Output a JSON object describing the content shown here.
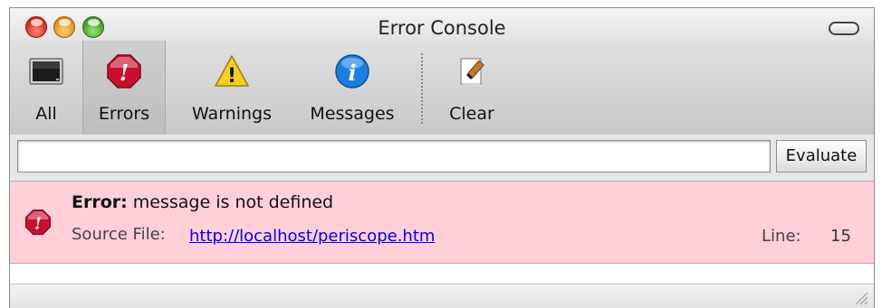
{
  "window": {
    "title": "Error Console"
  },
  "toolbar": {
    "items": [
      {
        "label": "All",
        "icon": "monitor-icon"
      },
      {
        "label": "Errors",
        "icon": "error-stop-icon",
        "selected": true
      },
      {
        "label": "Warnings",
        "icon": "warning-icon"
      },
      {
        "label": "Messages",
        "icon": "info-icon"
      },
      {
        "label": "Clear",
        "icon": "eraser-icon"
      }
    ]
  },
  "evaluate": {
    "value": "",
    "placeholder": "",
    "button_label": "Evaluate"
  },
  "messages": [
    {
      "type_label": "Error:",
      "text": "message is not defined",
      "source_label": "Source File:",
      "source_url": "http://localhost/periscope.htm",
      "line_label": "Line:",
      "line": "15"
    }
  ],
  "colors": {
    "error_row_bg": "#ffd0d8",
    "error_icon": "#c8102e",
    "info_icon": "#1a7fe0",
    "warning_icon": "#f5d020",
    "link": "#0000ee"
  }
}
